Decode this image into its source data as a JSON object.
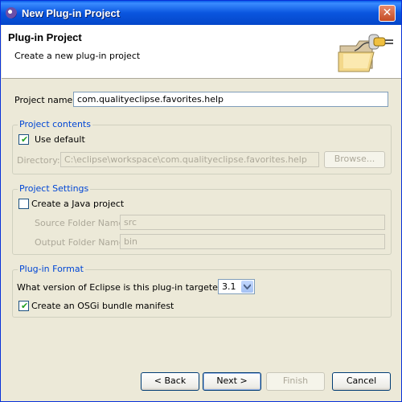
{
  "window": {
    "title": "New Plug-in Project",
    "close_glyph": "✕"
  },
  "header": {
    "title": "Plug-in Project",
    "description": "Create a new plug-in project",
    "icon": "new-plugin-folder-wizard-icon"
  },
  "project_name": {
    "label": "Project name:",
    "value": "com.qualityeclipse.favorites.help"
  },
  "project_contents": {
    "group_title": "Project contents",
    "use_default": {
      "label": "Use default",
      "checked": true
    },
    "directory": {
      "label": "Directory:",
      "value": "C:\\eclipse\\workspace\\com.qualityeclipse.favorites.help",
      "enabled": false
    },
    "browse_label": "Browse..."
  },
  "project_settings": {
    "group_title": "Project Settings",
    "java_project": {
      "label": "Create a Java project",
      "checked": false
    },
    "source_folder": {
      "label": "Source Folder Name:",
      "value": "src",
      "enabled": false
    },
    "output_folder": {
      "label": "Output Folder Name:",
      "value": "bin",
      "enabled": false
    }
  },
  "plugin_format": {
    "group_title": "Plug-in Format",
    "version_question": "What version of Eclipse is this plug-in targeted for?",
    "version_selected": "3.1",
    "osgi_manifest": {
      "label": "Create an OSGi bundle manifest",
      "checked": true
    }
  },
  "buttons": {
    "back": "< Back",
    "next": "Next >",
    "finish": "Finish",
    "cancel": "Cancel"
  },
  "colors": {
    "title_bar": "#0a56df",
    "group_title": "#0046d5",
    "dialog_bg": "#ece9d8"
  }
}
